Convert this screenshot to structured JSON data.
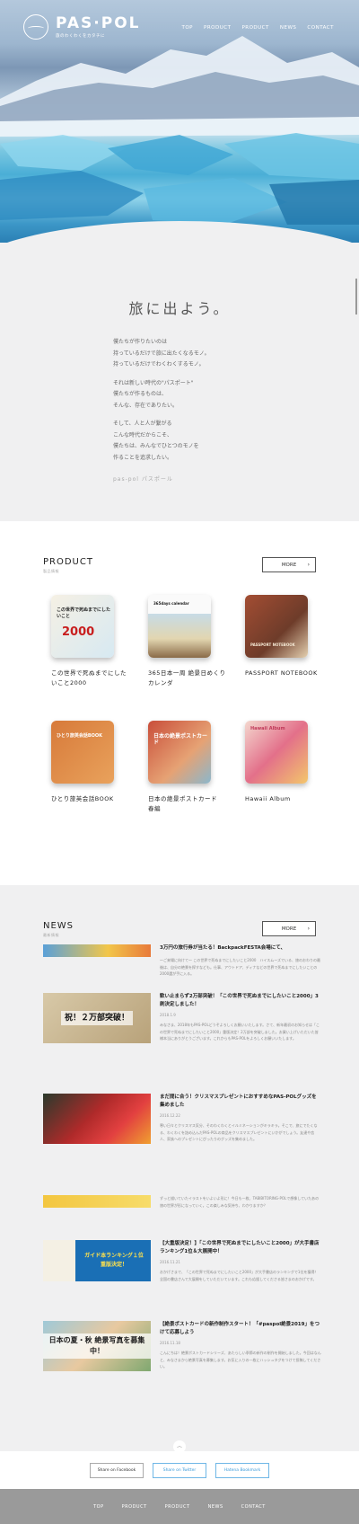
{
  "brand": {
    "name": "PAS·POL",
    "tagline": "旅のわくわくをカタチに"
  },
  "nav": [
    "TOP",
    "PRODUCT",
    "PRODUCT",
    "NEWS",
    "CONTACT"
  ],
  "intro": {
    "title": "旅に出よう。",
    "paragraphs": [
      [
        "僕たちが作りたいのは",
        "持っているだけで旅に出たくなるモノ。",
        "持っているだけでわくわくするモノ。"
      ],
      [
        "それは新しい時代の\"パスポート\"",
        "僕たちが作るものは、",
        "そんな、存在でありたい。"
      ],
      [
        "そして、人と人が繋がる",
        "こんな時代だからこそ、",
        "僕たちは、みんなでひとつのモノを",
        "作ることを追求したい。"
      ]
    ],
    "faded": "pas-pol パスポール"
  },
  "product": {
    "title": "PRODUCT",
    "subtitle": "製品情報",
    "more_label": "MORE",
    "items": [
      {
        "name": "この世界で死ぬまでにしたいこと2000",
        "cover": "この世界で死ぬまでにしたいこと",
        "num": "2000"
      },
      {
        "name": "365日本一周 絶景日めくりカレンダ",
        "cover": "365days calendar",
        "num": ""
      },
      {
        "name": "PASSPORT NOTEBOOK",
        "cover": "PASSPORT NOTEBOOK",
        "num": ""
      },
      {
        "name": "ひとり旅英会話BOOK",
        "cover": "ひとり旅英会話BOOK",
        "num": ""
      },
      {
        "name": "日本の絶景ポストカード　春編",
        "cover": "日本の絶景ポストカード",
        "num": ""
      },
      {
        "name": "Hawaii Album",
        "cover": "Hawaii Album",
        "num": ""
      }
    ]
  },
  "news": {
    "title": "NEWS",
    "subtitle": "最新情報",
    "more_label": "MORE",
    "items": [
      {
        "title": "3万円の旅行券が当たる！BackpackFESTA会場にて、",
        "date": "",
        "excerpt": "〜ご来場に向けて〜 この世界で死ぬまでにしたいこと2000　ハイスムーズでいる、旅のおわりの最後は、自分の絶景を探すなども。仕事、アウトドア、ディナなどの世界で死ぬまでにしたいことの2000選が手に入る。",
        "thumb": ""
      },
      {
        "title": "歓い止まらず2万部突破！「この世界で死ぬまでにしたいこと2000」3刷決定しました！",
        "date": "2018.1.9",
        "excerpt": "みなさま、2018年もPAS-POLどうぞよろしくお願いいたします。さて、新年最初のお知らせは「この世界で死ぬまでにしたいこと2000」重版決定！2万部を突破しました。お買い上げいただいた皆様本当にありがとうございます。これからもPAS-POLをよろしくお願いいたします。",
        "thumb": "祝！２万部突破！"
      },
      {
        "title": "まだ間に合う！クリスマスプレゼントにおすすめなPAS-POLグッズを集めました",
        "date": "2016.12.22",
        "excerpt": "寒い日々とクリスマス気分、そのわくわくとイルミネーションがキラキラ。そこで、旅にでたくなる、わくわくを詰め込んだPAS-POLの商品をクリスマスプレゼントにいかがでしょう。友達や恋人、家族へのプレゼントにぴったりのグッズを集めました。",
        "thumb": ""
      },
      {
        "title": "",
        "date": "",
        "excerpt": "ずっと描いていたイラストをいよいよ形に！今日も一枚、TABIBITORING-POLで想像していたあの旅の世界が形になっていく。この楽しみな気持ち、わかりますか？",
        "thumb": ""
      },
      {
        "title": "【大重版決定！】「この世界で死ぬまでにしたいこと2000」が大手書店ランキング1位＆大展開中！",
        "date": "2016.11.21",
        "excerpt": "おかげさまで、「この世界で死ぬまでにしたいこと2000」が大手書店のランキングで1位を獲得！全国の書店さんで大展開をしていただいています。これも応援してくださる皆さまのおかげです。",
        "thumb": "ガイド本ランキング１位 重版決定！"
      },
      {
        "title": "【絶景ポストカードの新作制作スタート！「#paspol絶景2019」をつけて応募しよう",
        "date": "2016.11.18",
        "excerpt": "こんにちは！絶景ポストカードシリーズ、あたらしい季節の新作の制作を開始しました。今回はなんと、みなさまから絶景写真を募集します。お気に入りの一枚にハッシュタグをつけて投稿してください。",
        "thumb": "日本の夏・秋 絶景写真を募集中！"
      }
    ]
  },
  "share": [
    "Share on Facebook",
    "Share on Twitter",
    "Hatena Bookmark"
  ],
  "footer": [
    "TOP",
    "PRODUCT",
    "PRODUCT",
    "NEWS",
    "CONTACT"
  ],
  "colors": {
    "accent": "#3a9ad9",
    "footer": "#9a9a9a",
    "ice": "#4aaed6"
  }
}
